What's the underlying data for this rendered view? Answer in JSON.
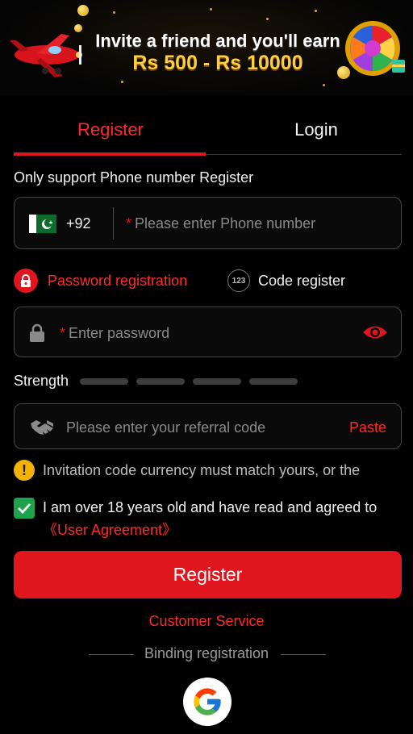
{
  "banner": {
    "line1": "Invite a friend and you'll earn",
    "line2": "Rs 500 - Rs 10000"
  },
  "tabs": [
    {
      "label": "Register",
      "active": true
    },
    {
      "label": "Login",
      "active": false
    }
  ],
  "hint": "Only support Phone number Register",
  "phone": {
    "country_code": "+92",
    "required_mark": "*",
    "placeholder": "Please enter Phone number"
  },
  "modes": {
    "password": "Password registration",
    "code_icon": "123",
    "code": "Code register"
  },
  "password": {
    "required_mark": "*",
    "placeholder": "Enter password"
  },
  "strength": {
    "label": "Strength",
    "level": 0,
    "segments": 4
  },
  "referral": {
    "placeholder": "Please enter your referral code",
    "paste": "Paste"
  },
  "warning": {
    "icon": "!",
    "text": "Invitation code currency must match yours, or the"
  },
  "agreement": {
    "checked": true,
    "text": "I am over 18 years old and have read and agreed to",
    "link": "《User Agreement》"
  },
  "register_button": "Register",
  "customer_service": "Customer Service",
  "binding": "Binding registration",
  "colors": {
    "accent": "#e0161e",
    "check": "#1ea34a",
    "warning": "#f3b300",
    "background": "#000000"
  },
  "icons": [
    "plane-icon",
    "prize-wheel-icon",
    "pakistan-flag-icon",
    "lock-icon",
    "eye-icon",
    "handshake-icon",
    "warning-icon",
    "check-icon",
    "google-icon"
  ]
}
